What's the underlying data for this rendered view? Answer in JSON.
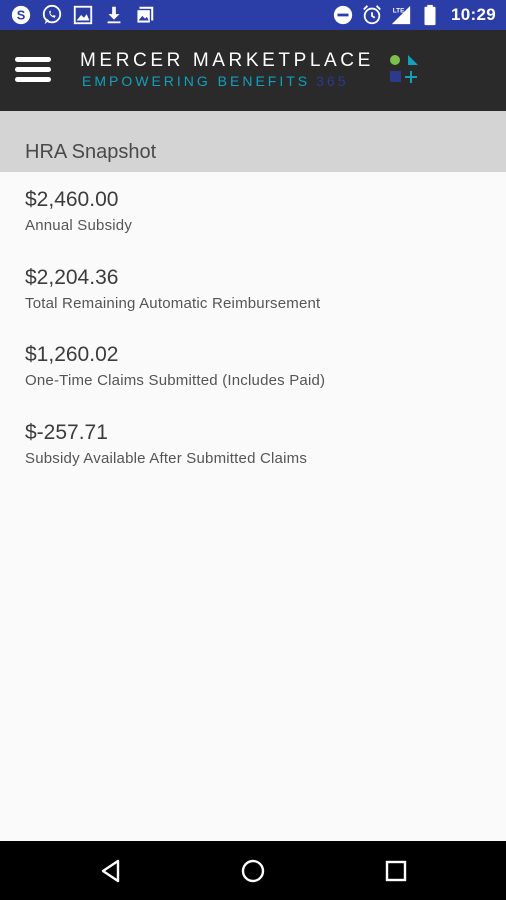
{
  "status_bar": {
    "time": "10:29",
    "network_label": "LTE",
    "left_icons": [
      "skype-icon",
      "whatsapp-icon",
      "image-icon",
      "download-icon",
      "gallery-icon"
    ],
    "right_icons": [
      "do-not-disturb-icon",
      "alarm-icon",
      "signal-icon",
      "battery-icon"
    ],
    "background": "#2b3ea8"
  },
  "header": {
    "brand_title": "MERCER MARKETPLACE",
    "brand_tagline": "EMPOWERING BENEFITS",
    "brand_tagline_number": "365",
    "colors": {
      "background": "#2a2a2a",
      "tagline": "#11a0be",
      "tagline_number": "#2c3a8c"
    }
  },
  "section": {
    "title": "HRA Snapshot"
  },
  "entries": [
    {
      "amount": "$2,460.00",
      "caption": "Annual Subsidy"
    },
    {
      "amount": "$2,204.36",
      "caption": "Total Remaining Automatic Reimbursement"
    },
    {
      "amount": "$1,260.02",
      "caption": "One-Time Claims Submitted (Includes Paid)"
    },
    {
      "amount": "$-257.71",
      "caption": "Subsidy Available After Submitted Claims"
    }
  ],
  "nav_bar": {
    "buttons": [
      "back-icon",
      "home-icon",
      "recents-icon"
    ]
  }
}
